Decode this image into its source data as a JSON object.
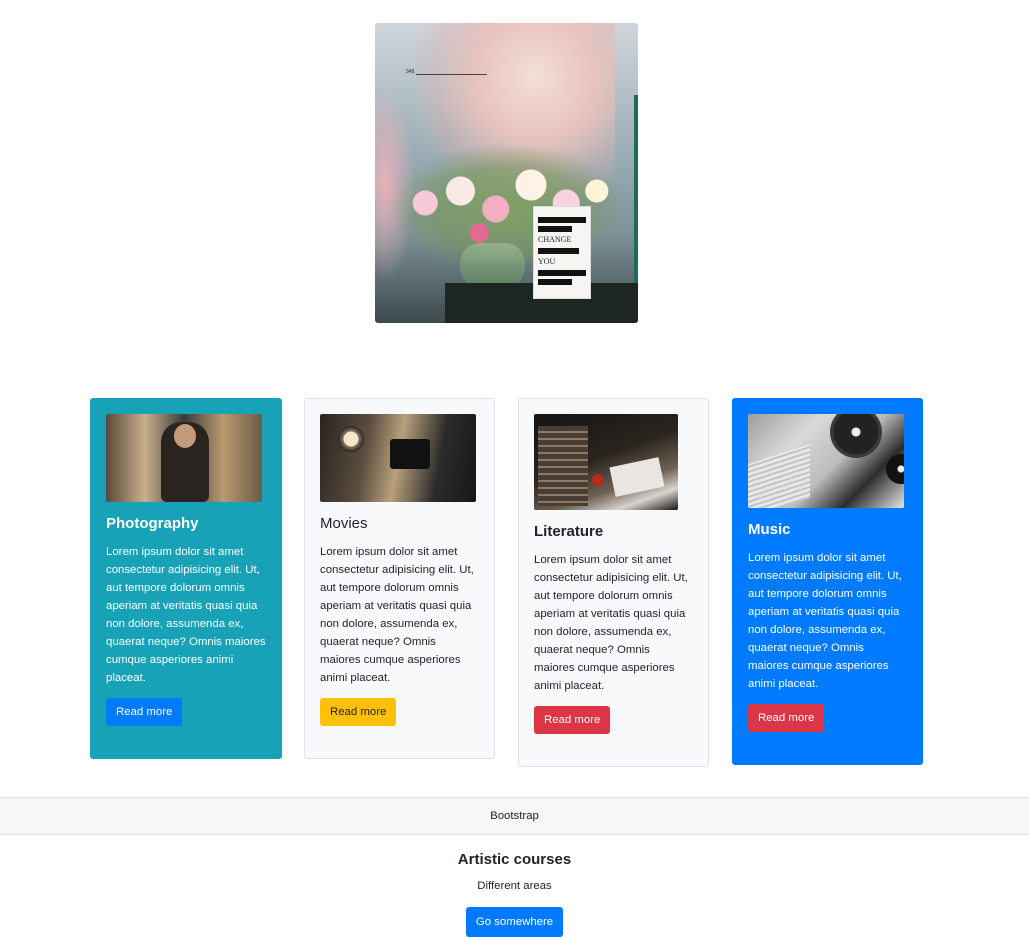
{
  "hero": {
    "image_icon": "flower-bouquet-image",
    "rule_number": "348",
    "book_text_1": "CHANGE",
    "book_text_2": "YOU"
  },
  "cards": [
    {
      "title": "Photography",
      "text": "Lorem ipsum dolor sit amet consectetur adipisicing elit. Ut, aut tempore dolorum omnis aperiam at veritatis quasi quia non dolore, assumenda ex, quaerat neque? Omnis maiores cumque asperiores animi placeat.",
      "button": "Read more",
      "background": "#17a2b8",
      "button_color": "#007bff",
      "image_icon": "photographer-image"
    },
    {
      "title": "Movies",
      "text": "Lorem ipsum dolor sit amet consectetur adipisicing elit. Ut, aut tempore dolorum omnis aperiam at veritatis quasi quia non dolore, assumenda ex, quaerat neque? Omnis maiores cumque asperiores animi placeat.",
      "button": "Read more",
      "background": "#f8f9fa",
      "button_color": "#ffc107",
      "image_icon": "film-camera-image"
    },
    {
      "title": "Literature",
      "text": "Lorem ipsum dolor sit amet consectetur adipisicing elit. Ut, aut tempore dolorum omnis aperiam at veritatis quasi quia non dolore, assumenda ex, quaerat neque? Omnis maiores cumque asperiores animi placeat.",
      "button": "Read more",
      "background": "#f8f9fa",
      "button_color": "#dc3545",
      "image_icon": "books-desk-image"
    },
    {
      "title": "Music",
      "text": "Lorem ipsum dolor sit amet consectetur adipisicing elit. Ut, aut tempore dolorum omnis aperiam at veritatis quasi quia non dolore, assumenda ex, quaerat neque? Omnis maiores cumque asperiores animi placeat.",
      "button": "Read more",
      "background": "#007bff",
      "button_color": "#dc3545",
      "image_icon": "turntable-laptop-image"
    }
  ],
  "footer": {
    "header": "Bootstrap",
    "title": "Artistic courses",
    "text": "Different areas",
    "button": "Go somewhere",
    "button_color": "#007bff"
  }
}
